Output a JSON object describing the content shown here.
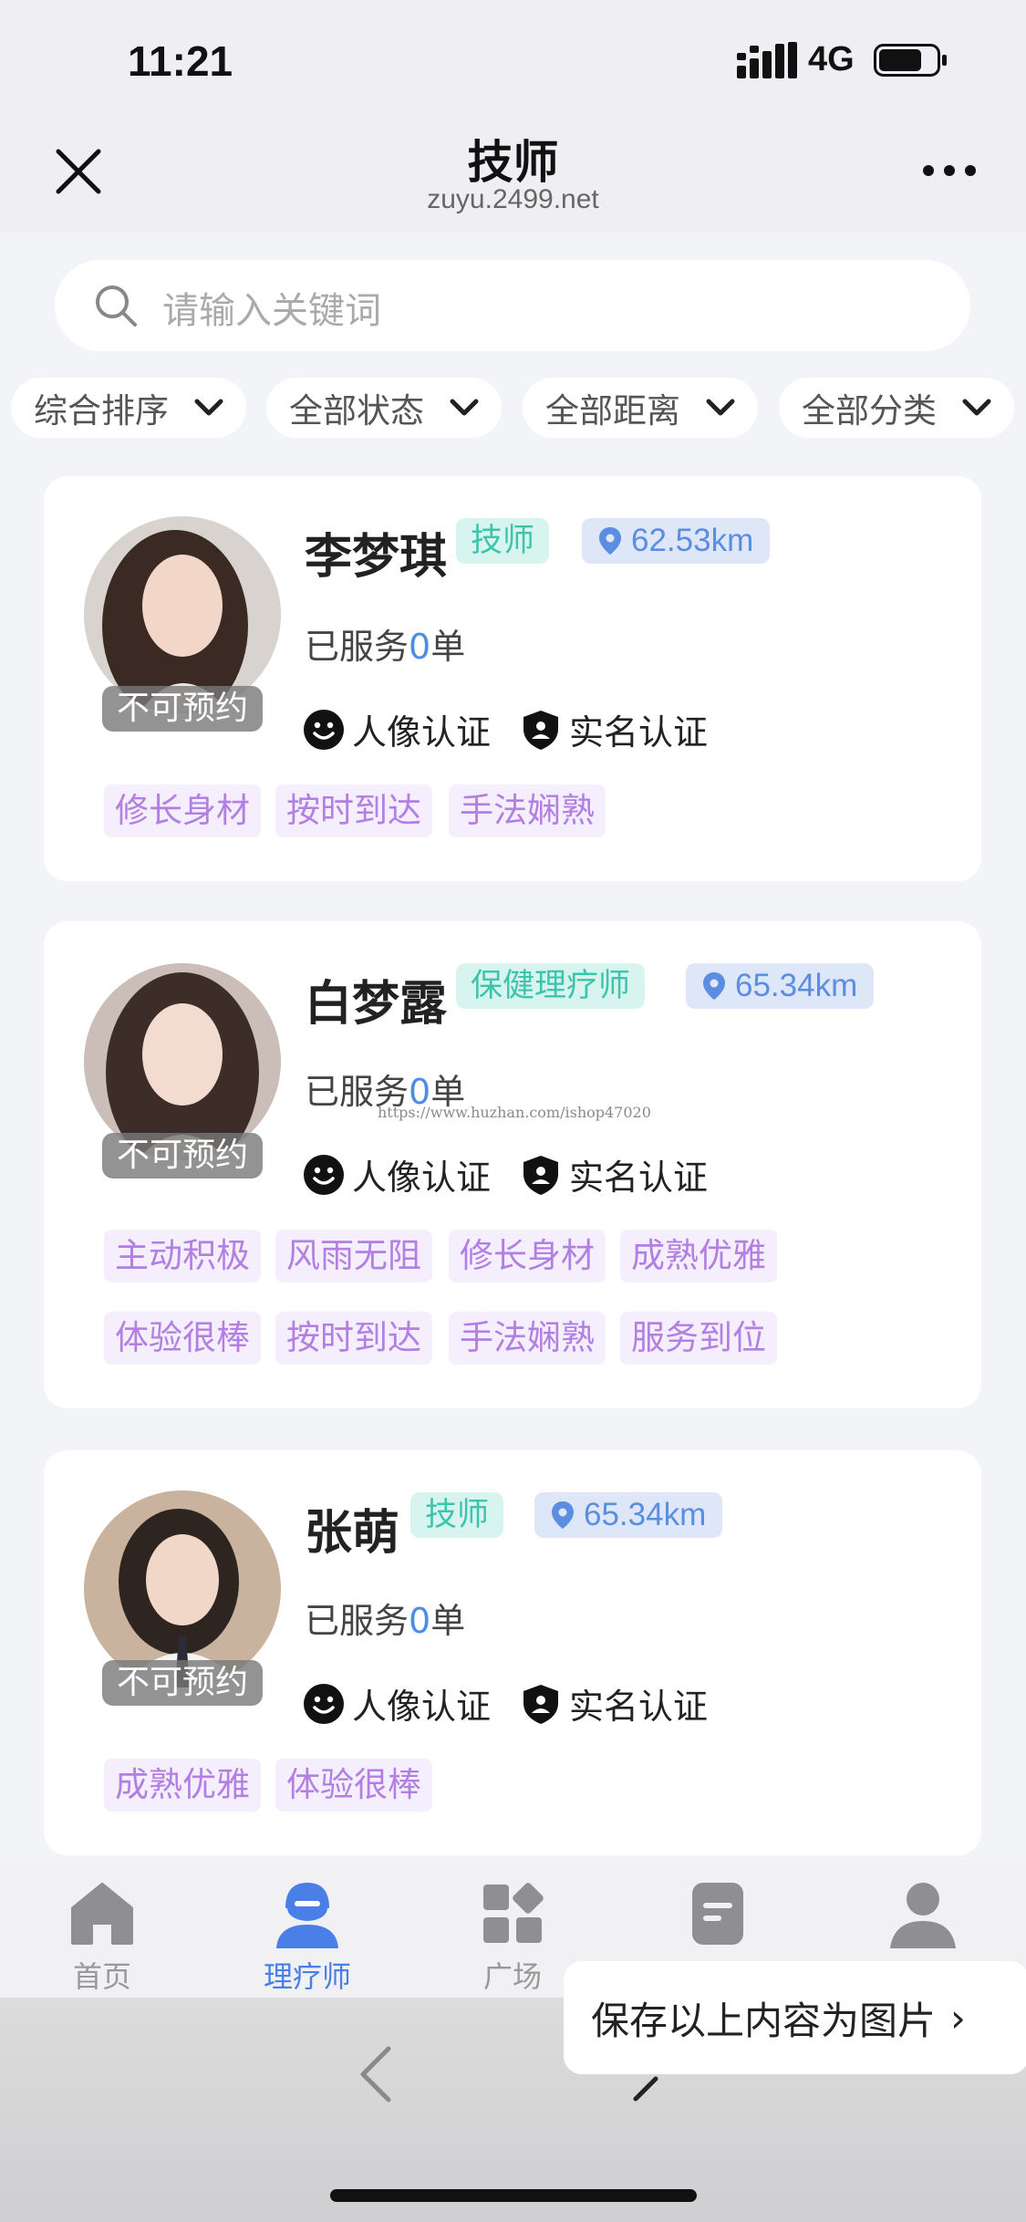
{
  "status_bar": {
    "time": "11:21",
    "network": "4G"
  },
  "nav": {
    "title": "技师",
    "url": "zuyu.2499.net"
  },
  "search": {
    "placeholder": "请输入关键词"
  },
  "filters": [
    "综合排序",
    "全部状态",
    "全部距离",
    "全部分类"
  ],
  "technicians": [
    {
      "name": "李梦琪",
      "role": "技师",
      "distance": "62.53km",
      "served_prefix": "已服务",
      "served_count": "0",
      "served_suffix": "单",
      "badge": "不可预约",
      "cert_face": "人像认证",
      "cert_real": "实名认证",
      "tags": [
        "修长身材",
        "按时到达",
        "手法娴熟"
      ]
    },
    {
      "name": "白梦露",
      "role": "保健理疗师",
      "distance": "65.34km",
      "served_prefix": "已服务",
      "served_count": "0",
      "served_suffix": "单",
      "badge": "不可预约",
      "cert_face": "人像认证",
      "cert_real": "实名认证",
      "tags": [
        "主动积极",
        "风雨无阻",
        "修长身材",
        "成熟优雅",
        "体验很棒",
        "按时到达",
        "手法娴熟",
        "服务到位"
      ]
    },
    {
      "name": "张萌",
      "role": "技师",
      "distance": "65.34km",
      "served_prefix": "已服务",
      "served_count": "0",
      "served_suffix": "单",
      "badge": "不可预约",
      "cert_face": "人像认证",
      "cert_real": "实名认证",
      "tags": [
        "成熟优雅",
        "体验很棒"
      ]
    }
  ],
  "tabbar": [
    {
      "label": "首页",
      "icon": "home-icon",
      "active": false
    },
    {
      "label": "理疗师",
      "icon": "therapist-icon",
      "active": true
    },
    {
      "label": "广场",
      "icon": "square-icon",
      "active": false
    },
    {
      "label": "",
      "icon": "order-icon",
      "active": false
    },
    {
      "label": "",
      "icon": "user-icon",
      "active": false
    }
  ],
  "watermark": "https://www.huzhan.com/ishop47020",
  "save_popup": {
    "label": "保存以上内容为图片",
    "arrow": "›"
  },
  "colors": {
    "accent": "#4a7fe8",
    "role_text": "#3cc4ad",
    "tag_text": "#b27fe3",
    "distance_text": "#5b8de0"
  }
}
